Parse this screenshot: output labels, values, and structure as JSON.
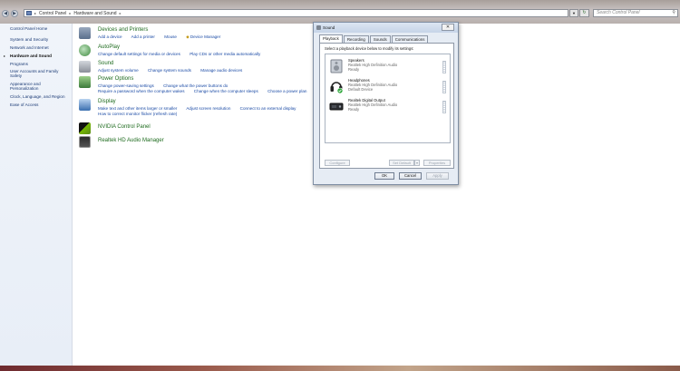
{
  "address_bar": {
    "crumbs": [
      "Control Panel",
      "Hardware and Sound"
    ],
    "search_placeholder": "Search Control Panel"
  },
  "sidebar": {
    "items": [
      {
        "label": "Control Panel Home"
      },
      {
        "label": "System and Security"
      },
      {
        "label": "Network and Internet"
      },
      {
        "label": "Hardware and Sound",
        "active": true
      },
      {
        "label": "Programs"
      },
      {
        "label": "User Accounts and Family"
      },
      {
        "label": "Safety"
      },
      {
        "label": "Appearance and"
      },
      {
        "label": "Personalization"
      },
      {
        "label": "Clock, Language, and Region"
      },
      {
        "label": "Ease of Access"
      }
    ]
  },
  "categories": [
    {
      "title": "Devices and Printers",
      "icon": "printer-icon",
      "color": "#5a6f8c",
      "lines": [
        [
          "Add a device",
          "Add a printer",
          "Mouse",
          "Device Manager"
        ]
      ]
    },
    {
      "title": "AutoPlay",
      "icon": "autoplay-icon",
      "color": "#3f8a3f",
      "lines": [
        [
          "Change default settings for media or devices",
          "Play CDs or other media automatically"
        ]
      ]
    },
    {
      "title": "Sound",
      "icon": "speaker-icon",
      "color": "#8a8f99",
      "lines": [
        [
          "Adjust system volume",
          "Change system sounds",
          "Manage audio devices"
        ]
      ]
    },
    {
      "title": "Power Options",
      "icon": "power-icon",
      "color": "#3b7a3b",
      "lines": [
        [
          "Change power-saving settings",
          "Change what the power buttons do"
        ],
        [
          "Require a password when the computer wakes",
          "Change when the computer sleeps",
          "Choose a power plan"
        ]
      ]
    },
    {
      "title": "Display",
      "icon": "display-icon",
      "color": "#3a6fb0",
      "lines": [
        [
          "Make text and other items larger or smaller",
          "Adjust screen resolution",
          "Connect to an external display"
        ],
        [
          "How to correct monitor flicker (refresh rate)"
        ]
      ]
    },
    {
      "title": "NVIDIA Control Panel",
      "icon": "nvidia-icon",
      "color": "#5a8a1a",
      "lines": []
    },
    {
      "title": "Realtek HD Audio Manager",
      "icon": "realtek-icon",
      "color": "#2d5a2d",
      "lines": []
    }
  ],
  "dialog": {
    "title": "Sound",
    "tabs": [
      "Playback",
      "Recording",
      "Sounds",
      "Communications"
    ],
    "instruction": "Select a playback device below to modify its settings:",
    "devices": [
      {
        "name": "Speakers",
        "driver": "Realtek High Definition Audio",
        "status": "Ready",
        "icon": "speaker-device-icon"
      },
      {
        "name": "Headphones",
        "driver": "Realtek High Definition Audio",
        "status": "Default Device",
        "icon": "headphones-icon"
      },
      {
        "name": "Realtek Digital Output",
        "driver": "Realtek High Definition Audio",
        "status": "Ready",
        "icon": "digital-output-icon"
      }
    ],
    "buttons": {
      "configure": "Configure",
      "set_default": "Set Default",
      "properties": "Properties",
      "ok": "OK",
      "cancel": "Cancel",
      "apply": "Apply"
    }
  }
}
